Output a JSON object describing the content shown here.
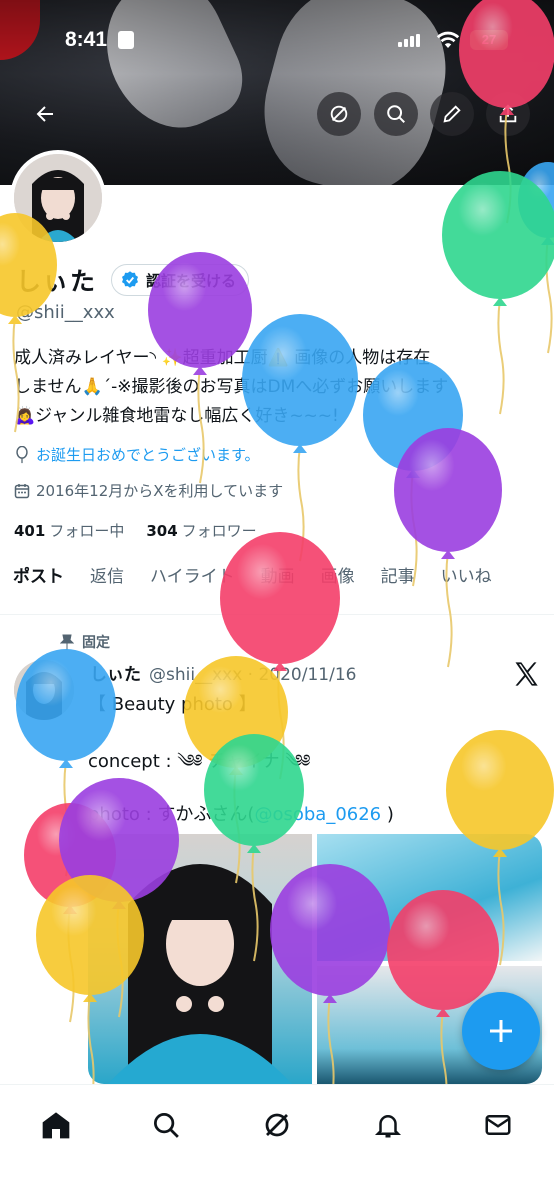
{
  "status_bar": {
    "time": "8:41",
    "battery": "27"
  },
  "profile": {
    "display_name": "しぃた",
    "verify_label": "認証を受ける",
    "handle": "@shii__xxx",
    "bio": "成人済みレイヤー◝ ✨超重加工厨⚠️ 画像の人物は存在\nしません🙏´-※撮影後のお写真はDMへ必ずお願いします\n🙇‍♀️ジャンル雑食地雷なし幅広く好き~~~!",
    "birthday_text": "お誕生日おめでとうございます。",
    "joined_text": "2016年12月からXを利用しています",
    "following_count": "401",
    "following_label": "フォロー中",
    "followers_count": "304",
    "followers_label": "フォロワー"
  },
  "tabs": [
    {
      "label": "ポスト"
    },
    {
      "label": "返信"
    },
    {
      "label": "ハイライト"
    },
    {
      "label": "動画"
    },
    {
      "label": "画像"
    },
    {
      "label": "記事"
    },
    {
      "label": "いいね"
    }
  ],
  "post": {
    "pinned_label": "固定",
    "author": "しぃた",
    "handle_date": "@shii__xxx · 2020/11/16",
    "line1": "【 Beauty photo 】",
    "line2": "concept : ༄༅ チャイナ ༄༅",
    "line3_prefix": "photo : すかふさん(",
    "line3_mention": "@osoba_0626",
    "line3_suffix": " )"
  },
  "colors": {
    "accent": "#1d9bf0",
    "balloon_pink": "#f43f6a",
    "balloon_purple": "#9b3fe0",
    "balloon_blue": "#39a6f2",
    "balloon_green": "#2fd68f",
    "balloon_yellow": "#f7c72a"
  },
  "icons": {
    "back": "arrow-left-icon",
    "grok": "grok-icon",
    "search": "search-icon",
    "compose": "pencil-icon",
    "share": "share-icon",
    "verified": "verified-badge-icon",
    "balloon": "balloon-icon",
    "calendar": "calendar-icon",
    "pin": "pin-icon",
    "x": "x-logo-icon",
    "home": "home-icon",
    "bell": "bell-icon",
    "mail": "mail-icon",
    "plus": "plus-icon"
  }
}
